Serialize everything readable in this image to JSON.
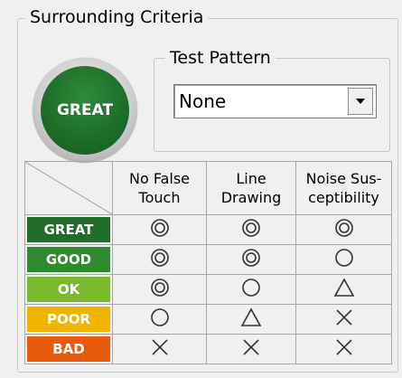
{
  "group": {
    "title": "Surrounding Criteria"
  },
  "result_button": {
    "label": "GREAT"
  },
  "test_pattern": {
    "title": "Test Pattern",
    "selected": "None"
  },
  "table": {
    "headers": [
      {
        "line1": "No False",
        "line2": "Touch"
      },
      {
        "line1": "Line",
        "line2": "Drawing"
      },
      {
        "line1": "Noise Sus-",
        "line2": "ceptibility"
      }
    ],
    "rows": [
      {
        "label": "GREAT",
        "color": "#1e6e2a",
        "symbols": [
          "double-circle-icon",
          "double-circle-icon",
          "double-circle-icon"
        ]
      },
      {
        "label": "GOOD",
        "color": "#2e8b2e",
        "symbols": [
          "double-circle-icon",
          "double-circle-icon",
          "circle-icon"
        ]
      },
      {
        "label": "OK",
        "color": "#7ab82c",
        "symbols": [
          "double-circle-icon",
          "circle-icon",
          "triangle-icon"
        ]
      },
      {
        "label": "POOR",
        "color": "#f0b400",
        "symbols": [
          "circle-icon",
          "triangle-icon",
          "cross-icon"
        ]
      },
      {
        "label": "BAD",
        "color": "#e85a0c",
        "symbols": [
          "cross-icon",
          "cross-icon",
          "cross-icon"
        ]
      }
    ]
  },
  "colors": {
    "great_button": "#1e6e2a",
    "grid": "#a6a6a6"
  }
}
